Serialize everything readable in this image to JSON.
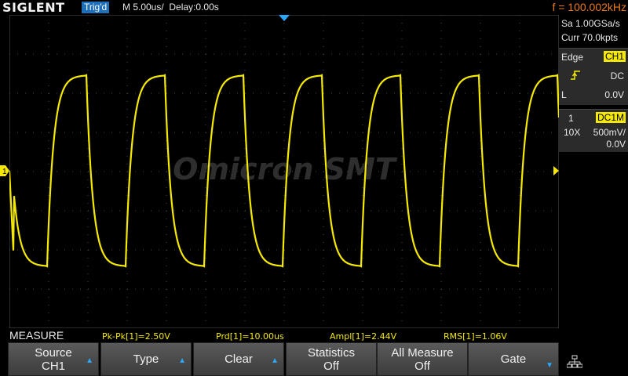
{
  "header": {
    "brand": "SIGLENT",
    "trigger_status": "Trig'd",
    "timebase": "M 5.00us/",
    "delay": "Delay:0.00s",
    "frequency": "f = 100.002kHz"
  },
  "acquisition": {
    "sample_rate": "Sa 1.00GSa/s",
    "memory_depth": "Curr 70.0kpts"
  },
  "trigger": {
    "mode_label": "Edge",
    "source": "CH1",
    "coupling": "DC",
    "level_label": "L",
    "level": "0.0V",
    "slope_icon": "rising-edge-icon"
  },
  "channel1": {
    "number": "1",
    "coupling": "DC1M",
    "probe": "10X",
    "scale": "500mV/",
    "offset": "0.0V",
    "marker": "1",
    "color": "#f5e900"
  },
  "watermark": "Omicron SMT",
  "measure": {
    "title": "MEASURE",
    "items": [
      "Pk-Pk[1]=2.50V",
      "Prd[1]=10.00us",
      "Ampl[1]=2.44V",
      "RMS[1]=1.06V"
    ]
  },
  "softkeys": [
    {
      "line1": "Source",
      "line2": "CH1",
      "arrow": "up"
    },
    {
      "line1": "Type",
      "line2": "",
      "arrow": "up"
    },
    {
      "line1": "Clear",
      "line2": "",
      "arrow": "up"
    },
    {
      "line1": "Statistics",
      "line2": "Off",
      "arrow": ""
    },
    {
      "line1": "All Measure",
      "line2": "Off",
      "arrow": ""
    },
    {
      "line1": "Gate",
      "line2": "",
      "arrow": "down"
    }
  ],
  "colors": {
    "trace": "#f5e900",
    "accent_blue": "#1c6fb8",
    "frequency": "#e87a1e",
    "grid": "#3a3a3a"
  }
}
